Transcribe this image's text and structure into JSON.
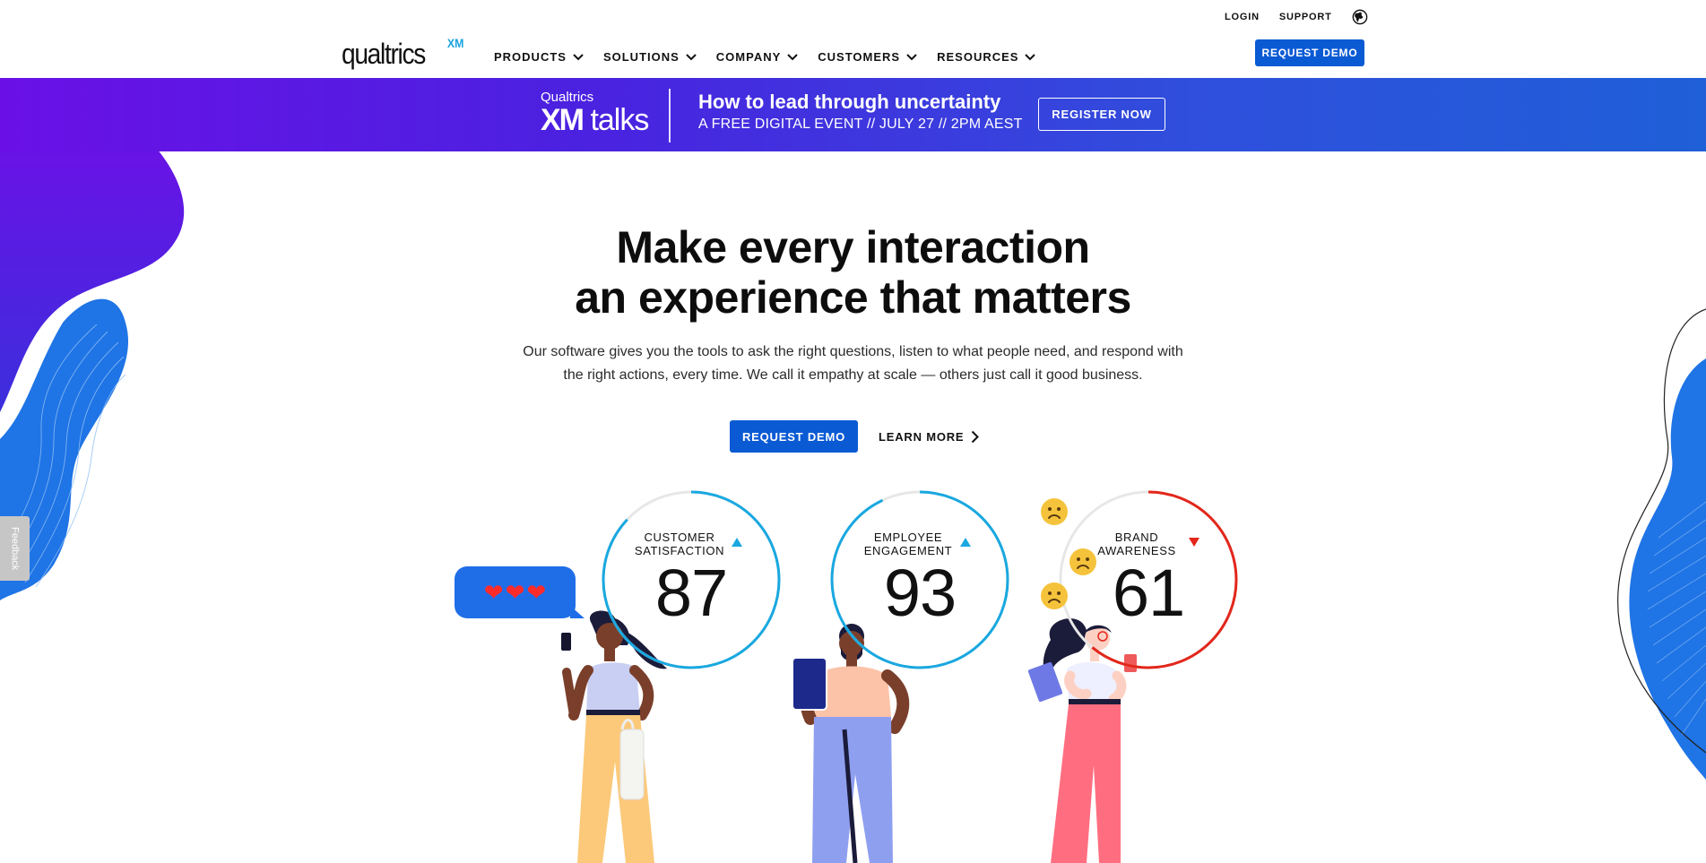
{
  "header": {
    "logo_text": "qualtrics",
    "logo_sup": "XM",
    "utility": {
      "login": "LOGIN",
      "support": "SUPPORT"
    },
    "nav": [
      "PRODUCTS",
      "SOLUTIONS",
      "COMPANY",
      "CUSTOMERS",
      "RESOURCES"
    ],
    "cta": "REQUEST DEMO"
  },
  "banner": {
    "brand_top": "Qualtrics",
    "brand_xm": "XM",
    "brand_talks": "talks",
    "headline": "How to lead through uncertainty",
    "subline": "A FREE DIGITAL EVENT // JULY 27 // 2PM AEST",
    "button": "REGISTER NOW"
  },
  "hero": {
    "title_line1": "Make every interaction",
    "title_line2": "an experience that matters",
    "subtitle_line1": "Our software gives you the tools to ask the right questions, listen to what people need, and respond with",
    "subtitle_line2": "the right actions, every time. We call it empathy at scale — others just call it good business.",
    "primary_cta": "REQUEST DEMO",
    "secondary_cta": "LEARN MORE"
  },
  "metrics": [
    {
      "label1": "CUSTOMER",
      "label2": "SATISFACTION",
      "value": "87",
      "trend": "up",
      "ring_color": "#19a8e0",
      "fill": 0.87
    },
    {
      "label1": "EMPLOYEE",
      "label2": "ENGAGEMENT",
      "value": "93",
      "trend": "up",
      "ring_color": "#19a8e0",
      "fill": 0.93
    },
    {
      "label1": "BRAND",
      "label2": "AWARENESS",
      "value": "61",
      "trend": "down",
      "ring_color": "#e3261b",
      "fill": 0.61
    }
  ],
  "feedback_tab": "Feedback",
  "colors": {
    "brand_blue": "#0a5ad4",
    "banner_start": "#6a10e6",
    "banner_end": "#1f5fd8",
    "ring_blue": "#19a8e0",
    "ring_red": "#e3261b"
  },
  "icons": [
    "globe-icon",
    "chevron-down-icon",
    "chevron-right-icon",
    "triangle-up-icon",
    "triangle-down-icon",
    "heart-icon",
    "sad-face-icon"
  ]
}
